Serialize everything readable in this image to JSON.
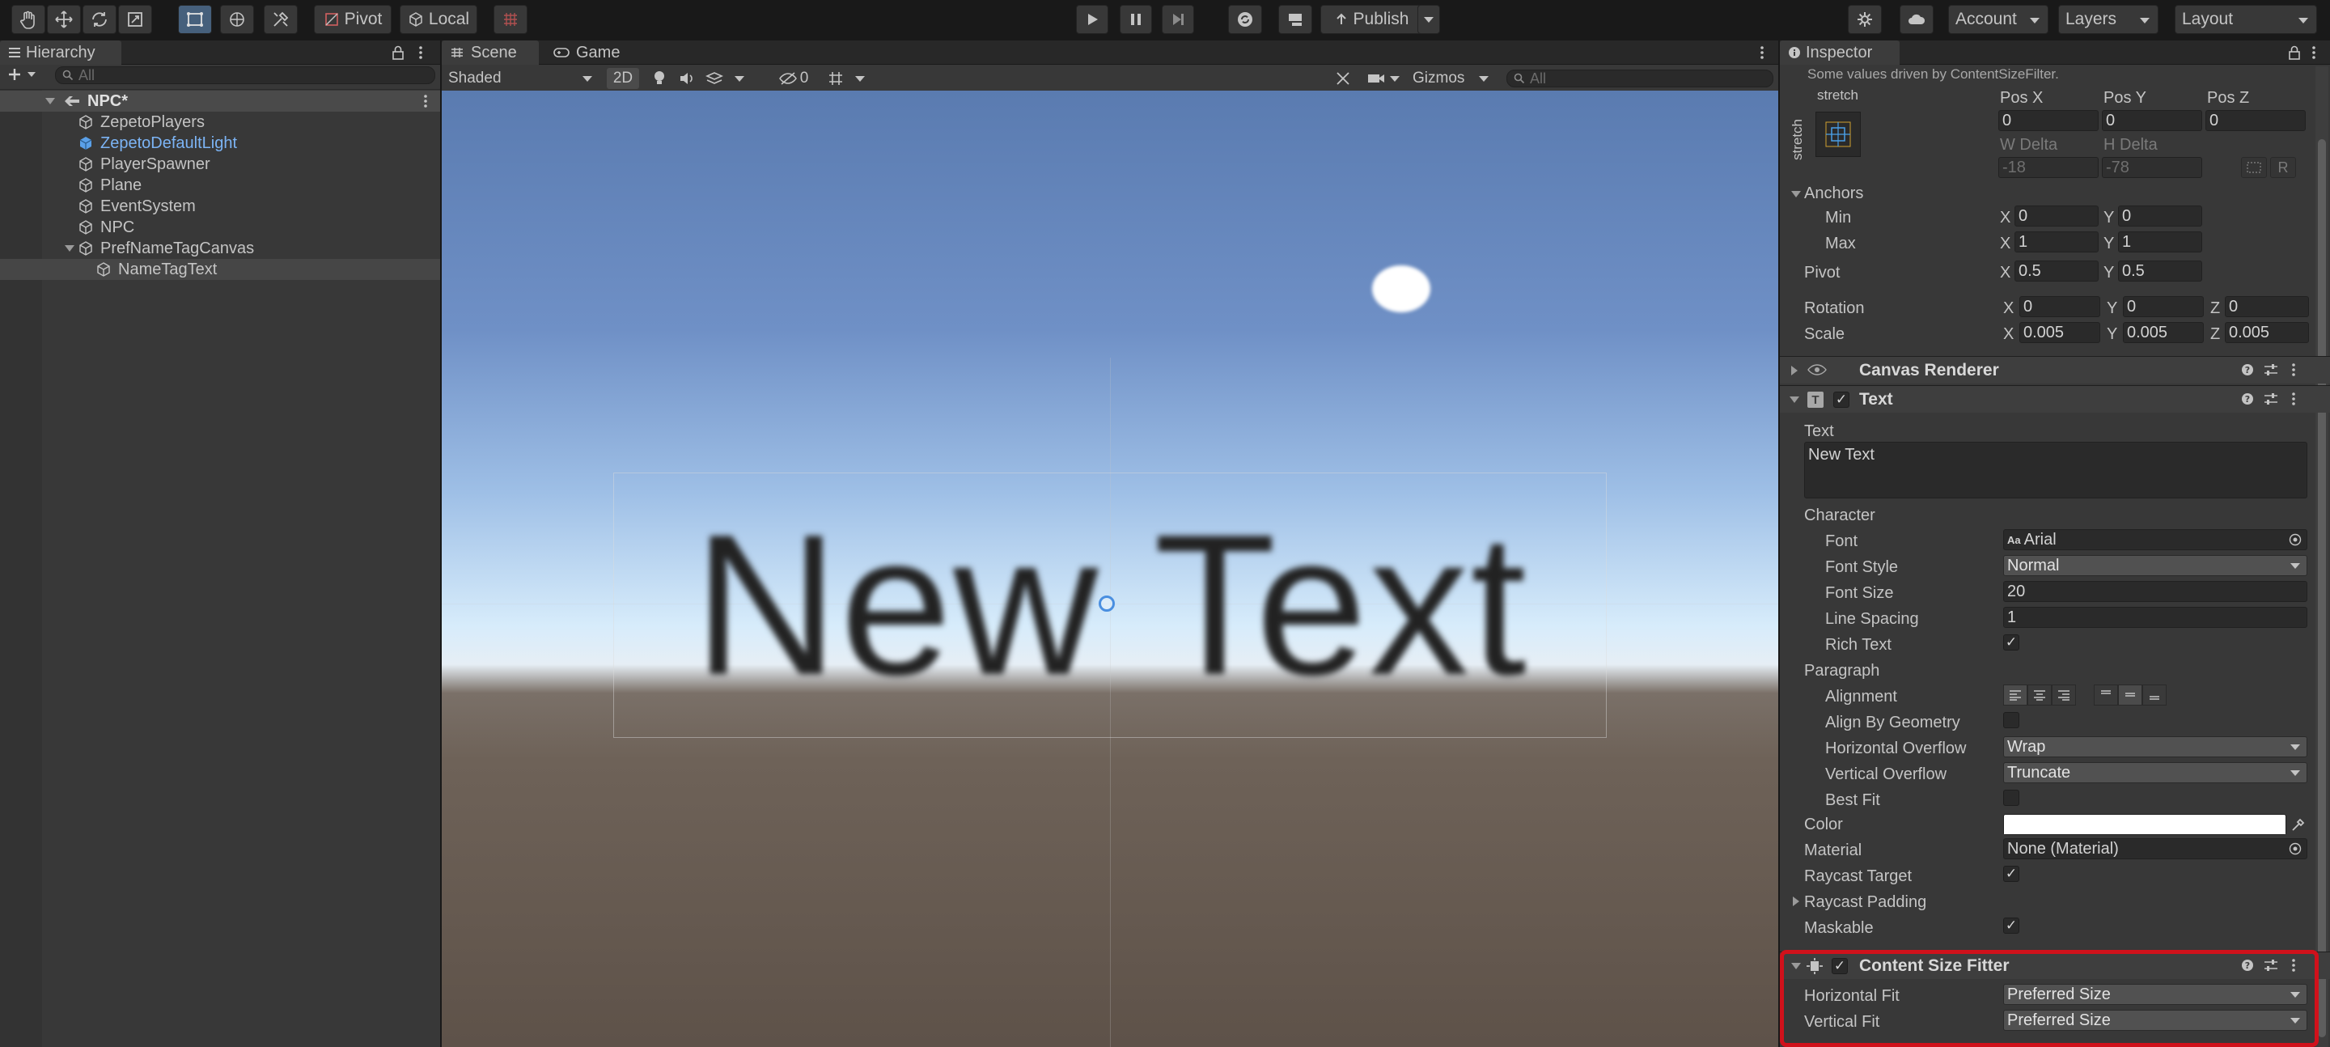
{
  "toolbar": {
    "tools": [
      "hand-tool",
      "move-tool",
      "rotate-tool",
      "scale-tool",
      "rect-tool",
      "transform-tool",
      "custom-tool"
    ],
    "pivot_label": "Pivot",
    "local_label": "Local",
    "publish_label": "Publish",
    "account_label": "Account",
    "layers_label": "Layers",
    "layout_label": "Layout"
  },
  "hierarchy": {
    "title": "Hierarchy",
    "search_placeholder": "All",
    "root": "NPC*",
    "items": [
      {
        "label": "ZepetoPlayers"
      },
      {
        "label": "ZepetoDefaultLight"
      },
      {
        "label": "PlayerSpawner"
      },
      {
        "label": "Plane"
      },
      {
        "label": "EventSystem"
      },
      {
        "label": "NPC"
      },
      {
        "label": "PrefNameTagCanvas"
      },
      {
        "label": "NameTagText"
      }
    ]
  },
  "scene": {
    "tab_scene": "Scene",
    "tab_game": "Game",
    "shading_mode": "Shaded",
    "mode_2d": "2D",
    "hidden_count": "0",
    "gizmos_label": "Gizmos",
    "search_placeholder": "All",
    "viewport_text": "New Text"
  },
  "inspector": {
    "title": "Inspector",
    "driven_note": "Some values driven by ContentSizeFilter.",
    "anchor_preset_label": "stretch",
    "anchor_preset_side": "stretch",
    "pos_x_label": "Pos X",
    "pos_y_label": "Pos Y",
    "pos_z_label": "Pos Z",
    "pos_x": "0",
    "pos_y": "0",
    "pos_z": "0",
    "w_delta_label": "W Delta",
    "h_delta_label": "H Delta",
    "w_delta": "-18",
    "h_delta": "-78",
    "r_label": "R",
    "anchors_label": "Anchors",
    "min_label": "Min",
    "max_label": "Max",
    "min_x": "0",
    "min_y": "0",
    "max_x": "1",
    "max_y": "1",
    "pivot_label": "Pivot",
    "pivot_x": "0.5",
    "pivot_y": "0.5",
    "rotation_label": "Rotation",
    "rot_x": "0",
    "rot_y": "0",
    "rot_z": "0",
    "scale_label": "Scale",
    "scale_x": "0.005",
    "scale_y": "0.005",
    "scale_z": "0.005",
    "axis_x": "X",
    "axis_y": "Y",
    "axis_z": "Z",
    "canvas_renderer_title": "Canvas Renderer",
    "text_component": {
      "title": "Text",
      "text_label": "Text",
      "text_value": "New Text",
      "character_label": "Character",
      "font_label": "Font",
      "font_value": "Arial",
      "font_prefix": "Aa",
      "font_style_label": "Font Style",
      "font_style_value": "Normal",
      "font_size_label": "Font Size",
      "font_size_value": "20",
      "line_spacing_label": "Line Spacing",
      "line_spacing_value": "1",
      "rich_text_label": "Rich Text",
      "rich_text_checked": true,
      "paragraph_label": "Paragraph",
      "alignment_label": "Alignment",
      "align_by_geometry_label": "Align By Geometry",
      "h_overflow_label": "Horizontal Overflow",
      "h_overflow_value": "Wrap",
      "v_overflow_label": "Vertical Overflow",
      "v_overflow_value": "Truncate",
      "best_fit_label": "Best Fit",
      "color_label": "Color",
      "color_value": "#ffffff",
      "material_label": "Material",
      "material_value": "None (Material)",
      "raycast_target_label": "Raycast Target",
      "raycast_padding_label": "Raycast Padding",
      "maskable_label": "Maskable"
    },
    "content_size_fitter": {
      "title": "Content Size Fitter",
      "horizontal_fit_label": "Horizontal Fit",
      "horizontal_fit_value": "Preferred Size",
      "vertical_fit_label": "Vertical Fit",
      "vertical_fit_value": "Preferred Size",
      "highlight_color": "#d0111b"
    }
  },
  "colors": {
    "prefab_blue": "#7cb4f5",
    "selection": "#464646",
    "accent_blue": "#46607c"
  }
}
